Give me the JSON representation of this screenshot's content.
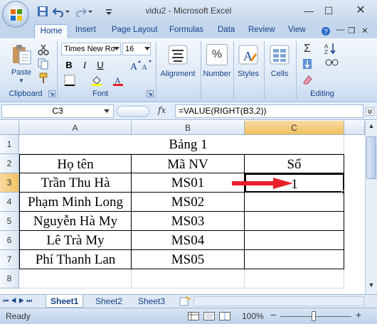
{
  "app": {
    "title": "vidu2 - Microsoft Excel"
  },
  "tabs": [
    "Home",
    "Insert",
    "Page Layout",
    "Formulas",
    "Data",
    "Review",
    "View"
  ],
  "ribbon": {
    "clipboard": {
      "paste": "Paste",
      "label": "Clipboard"
    },
    "font": {
      "name": "Times New Ro",
      "size": "16",
      "label": "Font",
      "bold": "B",
      "italic": "I",
      "underline": "U"
    },
    "alignment": "Alignment",
    "number": "Number",
    "number_icon": "%",
    "styles": "Styles",
    "cells": "Cells",
    "editing": "Editing",
    "sum": "Σ"
  },
  "formula_bar": {
    "name_box": "C3",
    "fx": "fx",
    "formula": "=VALUE(RIGHT(B3,2))"
  },
  "grid": {
    "columns": [
      "A",
      "B",
      "C"
    ],
    "rows": [
      "1",
      "2",
      "3",
      "4",
      "5",
      "6",
      "7",
      "8"
    ],
    "title": "Bảng 1",
    "headers": [
      "Họ tên",
      "Mã NV",
      "Số"
    ],
    "data": [
      [
        "Trần Thu Hà",
        "MS01",
        "1"
      ],
      [
        "Phạm Minh Long",
        "MS02",
        ""
      ],
      [
        "Nguyễn Hà My",
        "MS03",
        ""
      ],
      [
        "Lê Trà My",
        "MS04",
        ""
      ],
      [
        "Phí Thanh Lan",
        "MS05",
        ""
      ]
    ]
  },
  "sheets": [
    "Sheet1",
    "Sheet2",
    "Sheet3"
  ],
  "status": {
    "ready": "Ready",
    "zoom": "100%",
    "minus": "−",
    "plus": "+"
  },
  "colors": {
    "ribbon": "#dbe7f5",
    "arrow": "#e8202a",
    "accent": "#15428b"
  }
}
